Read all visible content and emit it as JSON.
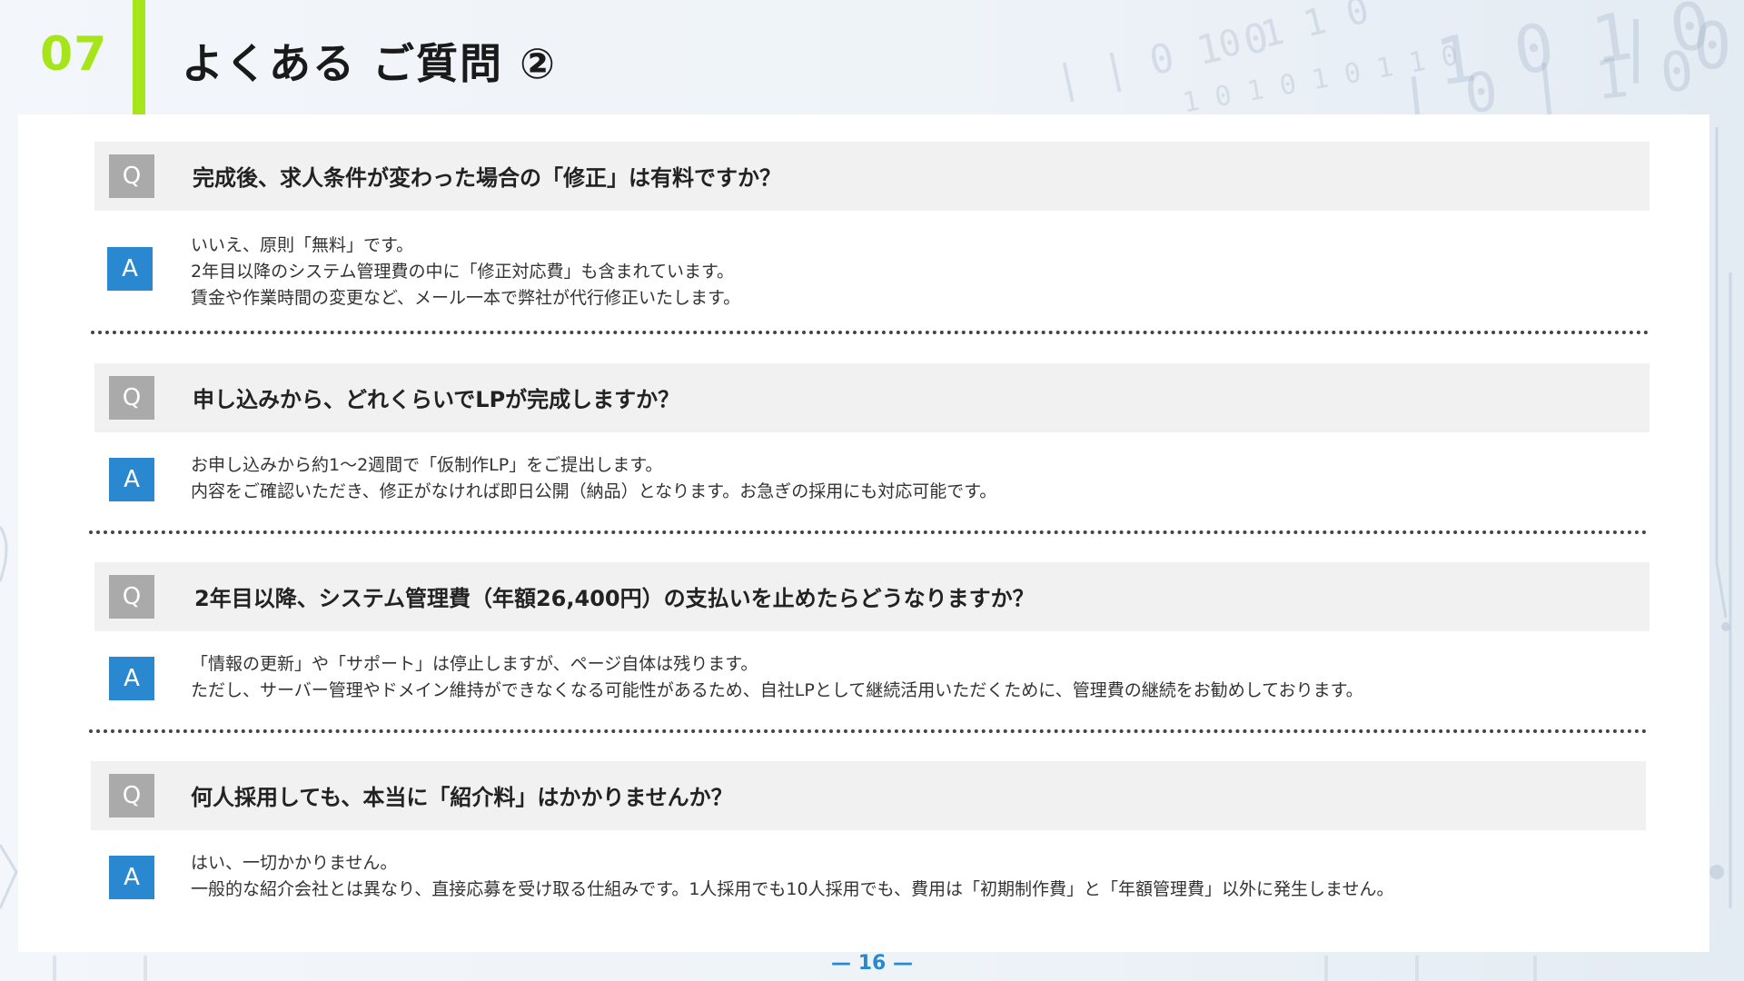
{
  "header": {
    "section_number": "07",
    "title": "よくある ご質問 ②"
  },
  "faq": [
    {
      "q_badge": "Q",
      "question": "完成後、求人条件が変わった場合の「修正」は有料ですか？",
      "a_badge": "A",
      "answer_lines": [
        "いいえ、原則「無料」です。",
        "2年目以降のシステム管理費の中に「修正対応費」も含まれています。",
        "賃金や作業時間の変更など、メール一本で弊社が代行修正いたします。"
      ]
    },
    {
      "q_badge": "Q",
      "question": "申し込みから、どれくらいでLPが完成しますか？",
      "a_badge": "A",
      "answer_lines": [
        "お申し込みから約1～2週間で「仮制作LP」をご提出します。",
        "内容をご確認いただき、修正がなければ即日公開（納品）となります。お急ぎの採用にも対応可能です。"
      ]
    },
    {
      "q_badge": "Q",
      "question": "2年目以降、システム管理費（年額26,400円）の支払いを止めたらどうなりますか？",
      "a_badge": "A",
      "answer_lines": [
        "「情報の更新」や「サポート」は停止しますが、ページ自体は残ります。",
        " ただし、サーバー管理やドメイン維持ができなくなる可能性があるため、自社LPとして継続活用いただくために、管理費の継続をお勧めしております。"
      ]
    },
    {
      "q_badge": "Q",
      "question": "何人採用しても、本当に「紹介料」はかかりませんか？",
      "a_badge": "A",
      "answer_lines": [
        "はい、一切かかりません。",
        "一般的な紹介会社とは異なり、直接応募を受け取る仕組みです。1人採用でも10人採用でも、費用は「初期制作費」と「年額管理費」以外に発生しません。"
      ]
    }
  ],
  "footer": {
    "page_number": "— 16 —"
  },
  "colors": {
    "accent_green": "#a6e51a",
    "answer_blue": "#2a88d0",
    "question_gray": "#aaaaaa"
  }
}
